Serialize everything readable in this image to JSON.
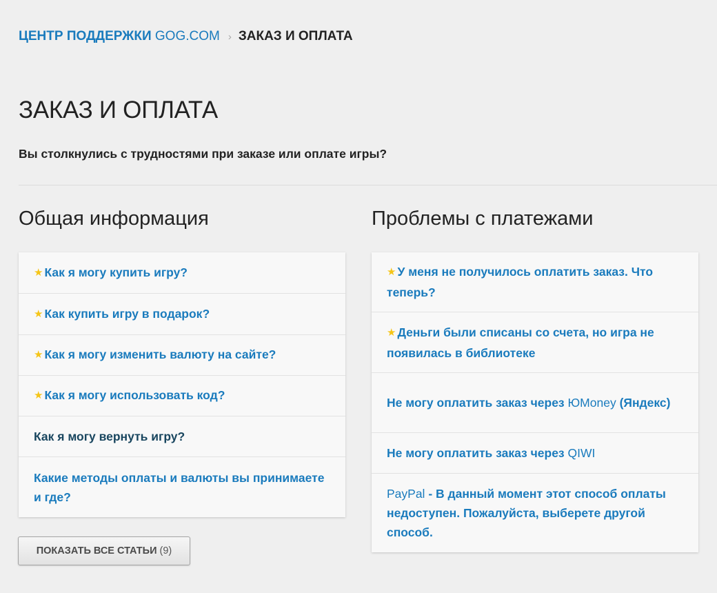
{
  "breadcrumb": {
    "root_prefix": "ЦЕНТР ПОДДЕРЖКИ",
    "root_brand": "GOG.COM",
    "separator": "›",
    "current": "ЗАКАЗ И ОПЛАТА"
  },
  "page": {
    "title": "ЗАКАЗ И ОПЛАТА",
    "description": "Вы столкнулись с трудностями при заказе или оплате игры?"
  },
  "general": {
    "title": "Общая информация",
    "items": [
      {
        "star": "★",
        "text": "Как я могу купить игру?"
      },
      {
        "star": "★",
        "text": "Как купить игру в подарок?"
      },
      {
        "star": "★",
        "text": "Как я могу изменить валюту на сайте?"
      },
      {
        "star": "★",
        "text": "Как я могу использовать код?"
      },
      {
        "text": "Как я могу вернуть игру?"
      },
      {
        "text": "Какие методы оплаты и валюты вы принимаете и где?"
      }
    ]
  },
  "payments": {
    "title": "Проблемы с платежами",
    "items": [
      {
        "star": "★",
        "text": "У меня не получилось оплатить заказ. Что теперь?"
      },
      {
        "star": "★",
        "text": "Деньги были списаны со счета, но игра не появилась в библиотеке"
      },
      {
        "text": "Не могу оплатить заказ через ",
        "brand": "ЮMoney",
        "after": " (Яндекс)"
      },
      {
        "text": "Не могу оплатить заказ через ",
        "brand": "QIWI"
      },
      {
        "brand": "PayPal",
        "text": " - В данный момент этот способ оплаты недоступен. Пожалуйста, выберете другой способ."
      }
    ]
  },
  "show_all": {
    "label": "ПОКАЗАТЬ ВСЕ СТАТЬИ",
    "count": "(9)"
  },
  "colors": {
    "link": "#1a7bbd",
    "visited_link": "#19465f",
    "star": "#f5c518",
    "background": "#efefef"
  }
}
